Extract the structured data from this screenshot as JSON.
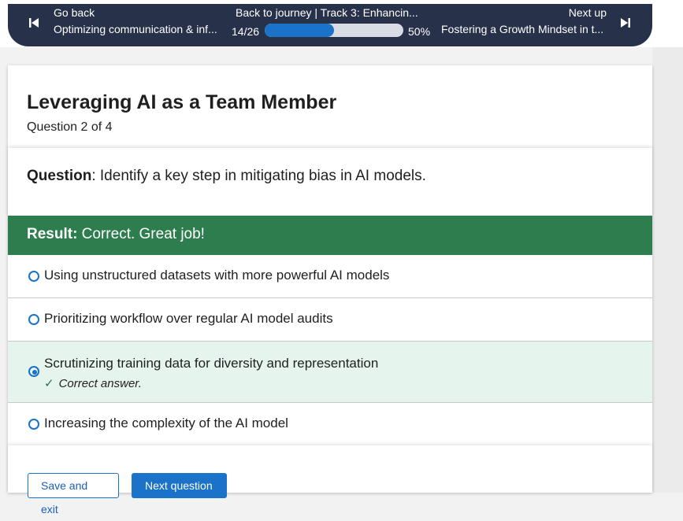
{
  "nav": {
    "back_label": "Go back",
    "back_title": "Optimizing communication & inf...",
    "journey": "Back to journey  |  Track 3: Enhancin...",
    "count": "14/26",
    "progress_fraction": 0.5,
    "progress_pct": "50%",
    "next_label": "Next up",
    "next_title": "Fostering a Growth Mindset in t..."
  },
  "quiz": {
    "title": "Leveraging AI as a Team Member",
    "subtitle": "Question 2 of 4",
    "question_label": "Question",
    "question_text": ": Identify a key step in mitigating bias in AI models.",
    "result_label": "Result:",
    "result_text": " Correct. Great job!",
    "options": [
      {
        "text": "Using unstructured datasets with more powerful AI models",
        "selected": false
      },
      {
        "text": "Prioritizing workflow over regular AI model audits",
        "selected": false
      },
      {
        "text": "Scrutinizing training data for diversity and representation",
        "selected": true,
        "note": "Correct answer."
      },
      {
        "text": "Increasing the complexity of the AI model",
        "selected": false
      }
    ]
  },
  "buttons": {
    "save_exit": "Save and exit",
    "next_question": "Next question"
  },
  "colors": {
    "nav_bg": "#27324a",
    "accent": "#1a73c8",
    "result_green": "#2e7d4f",
    "selected_bg": "#e6f4ee"
  }
}
